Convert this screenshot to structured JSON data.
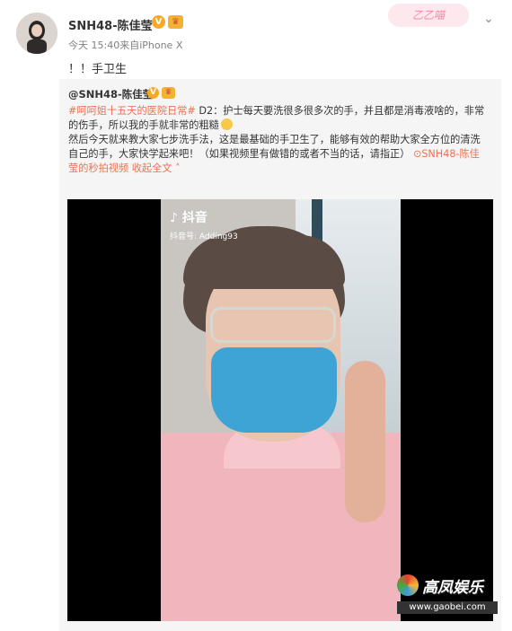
{
  "post": {
    "username": "SNH48-陈佳莹",
    "verified_icon": "v-badge-icon",
    "crown_icon": "crown-icon",
    "meta": "今天 15:40来自iPhone X",
    "text": "！！手卫生",
    "deco": "乙乙喵"
  },
  "repost": {
    "author": "@SNH48-陈佳莹",
    "hashtag": "#呵呵姐十五天的医院日常#",
    "line1_rest": " D2：护士每天要洗很多很多次的手，并且都是消毒液啥的，非常",
    "line2": "的伤手，所以我的手就非常的粗糙",
    "line3": "然后今天就来教大家七步洗手法，这是最基础的手卫生了，能够有效的帮助大家全方位的清洗",
    "line4": "自己的手，大家快学起来吧！（如果视频里有做错的或者不当的话，请指正）",
    "video_link_a": "SNH48-陈佳",
    "video_link_b": "莹的秒拍视频",
    "collapse": "收起全文",
    "collapse_icon": "chevron-up-icon"
  },
  "video": {
    "platform": "抖音",
    "account": "抖音号: Adding93"
  },
  "watermark": {
    "text": "高凤娱乐",
    "url": "www.gaobei.com"
  },
  "colors": {
    "link": "#eb7350",
    "repost_bg": "#f5f5f5"
  }
}
